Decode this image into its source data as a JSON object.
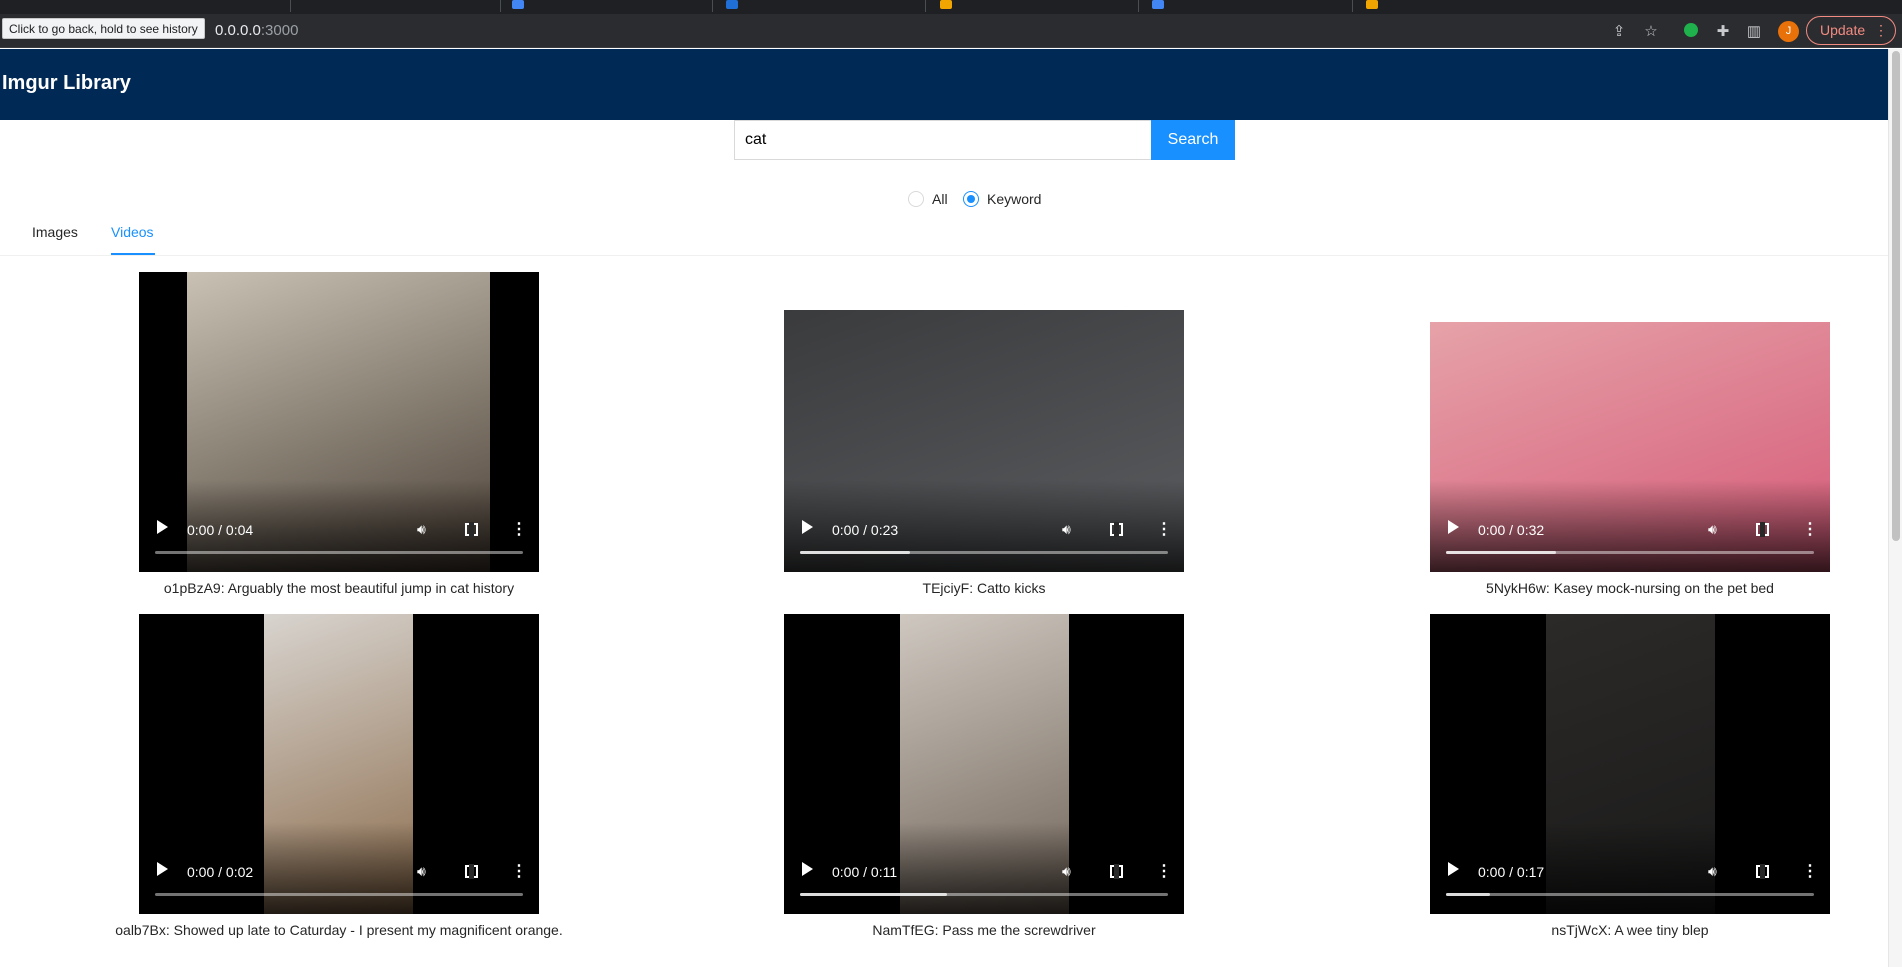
{
  "browser": {
    "url_host": "0.0.0.0",
    "url_port": ":3000",
    "back_tooltip": "Click to go back, hold to see history",
    "update_label": "Update",
    "profile_initial": "J"
  },
  "app": {
    "title": "Imgur Library",
    "search": {
      "value": "cat",
      "button_label": "Search"
    },
    "filter": {
      "options": [
        "All",
        "Keyword"
      ],
      "selected": "Keyword"
    },
    "tabs": [
      {
        "label": "Images"
      },
      {
        "label": "Videos"
      }
    ],
    "active_tab": "Videos",
    "videos": [
      {
        "time": "0:00 / 0:04",
        "caption": "o1pBzA9: Arguably the most beautiful jump in cat history",
        "progress": 0,
        "colors": [
          "#4a3f35",
          "#c9c2b4"
        ]
      },
      {
        "time": "0:00 / 0:23",
        "caption": "TEjciyF: Catto kicks",
        "progress": 0.3,
        "colors": [
          "#5b5d60",
          "#3a3b3d"
        ]
      },
      {
        "time": "0:00 / 0:32",
        "caption": "5NykH6w: Kasey mock-nursing on the pet bed",
        "progress": 0.3,
        "colors": [
          "#d55a78",
          "#e6a2a8"
        ]
      },
      {
        "time": "0:00 / 0:02",
        "caption": "oalb7Bx: Showed up late to Caturday - I present my magnificent orange.",
        "progress": 0,
        "colors": [
          "#8a6a4a",
          "#d8d4cf"
        ]
      },
      {
        "time": "0:00 / 0:11",
        "caption": "NamTfEG: Pass me the screwdriver",
        "progress": 0.4,
        "colors": [
          "#6f6358",
          "#cfc8c0"
        ]
      },
      {
        "time": "0:00 / 0:17",
        "caption": "nsTjWcX: A wee tiny blep",
        "progress": 0.12,
        "colors": [
          "#1a1a1a",
          "#2c2a28"
        ]
      }
    ]
  }
}
